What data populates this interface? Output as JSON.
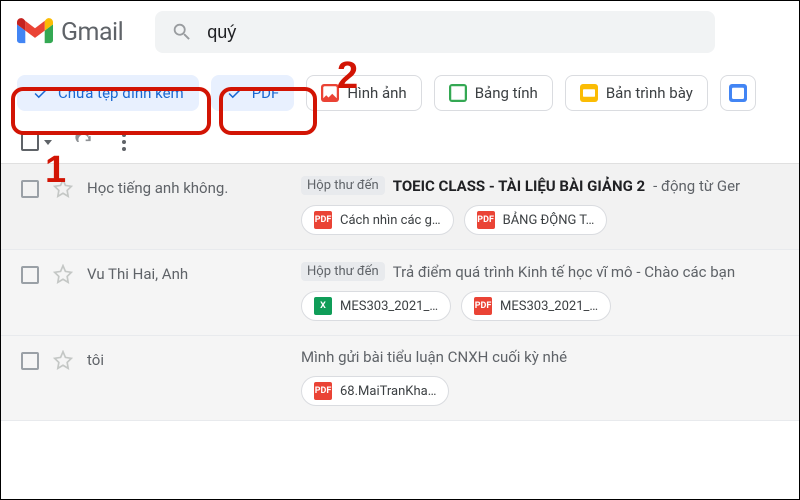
{
  "header": {
    "app_name": "Gmail",
    "search_value": "quý"
  },
  "filters": {
    "has_attachment": "Chứa tệp đính kèm",
    "pdf": "PDF",
    "image": "Hình ảnh",
    "spreadsheet": "Bảng tính",
    "presentation": "Bản trình bày"
  },
  "labels": {
    "inbox": "Hộp thư đến"
  },
  "emails": [
    {
      "sender": "Học tiếng anh không.",
      "subject_bold": "TOEIC CLASS - TÀI LIỆU BÀI GIẢNG 2",
      "subject_rest": " - động từ Ger",
      "show_inbox": true,
      "attachments": [
        {
          "type": "pdf",
          "name": "Cách nhìn các g…"
        },
        {
          "type": "pdf",
          "name": "BẢNG ĐỘNG T…"
        }
      ]
    },
    {
      "sender": "Vu Thi Hai, Anh",
      "subject_bold": "",
      "subject_rest": "Trả điểm quá trình Kinh tế học vĩ mô - Chào các bạn",
      "show_inbox": true,
      "attachments": [
        {
          "type": "xls",
          "name": "MES303_2021_…"
        },
        {
          "type": "pdf",
          "name": "MES303_2021_…"
        }
      ]
    },
    {
      "sender": "tôi",
      "subject_bold": "",
      "subject_rest": "Mình gửi bài tiểu luận CNXH cuối kỳ nhé",
      "show_inbox": false,
      "attachments": [
        {
          "type": "pdf",
          "name": "68.MaiTranKha…"
        }
      ]
    }
  ],
  "annotations": {
    "n1": "1",
    "n2": "2"
  }
}
